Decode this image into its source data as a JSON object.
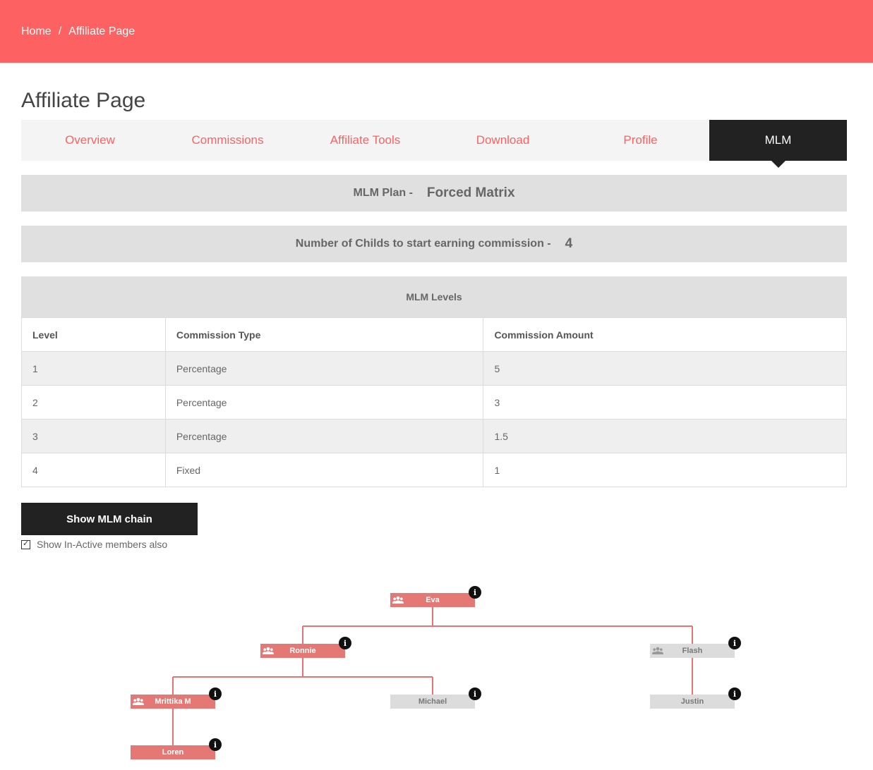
{
  "breadcrumb": {
    "home": "Home",
    "separator": "/",
    "current": "Affiliate Page"
  },
  "page": {
    "title": "Affiliate Page"
  },
  "tabs": [
    {
      "label": "Overview"
    },
    {
      "label": "Commissions"
    },
    {
      "label": "Affiliate Tools"
    },
    {
      "label": "Download"
    },
    {
      "label": "Profile"
    },
    {
      "label": "MLM",
      "active": true
    }
  ],
  "plan": {
    "label": "MLM Plan -",
    "value": "Forced Matrix"
  },
  "childs": {
    "label": "Number of Childs to start earning commission -",
    "value": "4"
  },
  "levels": {
    "heading": "MLM Levels",
    "columns": [
      "Level",
      "Commission Type",
      "Commission Amount"
    ],
    "rows": [
      [
        "1",
        "Percentage",
        "5"
      ],
      [
        "2",
        "Percentage",
        "3"
      ],
      [
        "3",
        "Percentage",
        "1.5"
      ],
      [
        "4",
        "Fixed",
        "1"
      ]
    ]
  },
  "chain_button": {
    "label": "Show MLM chain"
  },
  "inactive_checkbox": {
    "label": "Show In-Active members also",
    "checked": true
  },
  "tree": {
    "nodes": [
      {
        "name": "Eva",
        "status": "active",
        "has_children_icon": true
      },
      {
        "name": "Ronnie",
        "status": "active",
        "has_children_icon": true
      },
      {
        "name": "Flash",
        "status": "inactive",
        "has_children_icon": true
      },
      {
        "name": "Mrittika M",
        "status": "active",
        "has_children_icon": true
      },
      {
        "name": "Michael",
        "status": "inactive",
        "has_children_icon": false
      },
      {
        "name": "Justin",
        "status": "inactive",
        "has_children_icon": false
      },
      {
        "name": "Loren",
        "status": "active",
        "has_children_icon": false
      }
    ],
    "info_icon": "info-icon",
    "group_icon": "users-icon",
    "colors": {
      "active": "#e47875",
      "inactive": "#dcdcdc",
      "connector": "#e57373"
    }
  },
  "colors": {
    "accent": "#fe6161",
    "dark": "#222222",
    "panel": "#e0e0e0"
  }
}
